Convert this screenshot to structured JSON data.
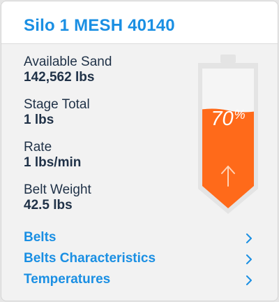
{
  "header": {
    "title": "Silo 1 MESH 40140"
  },
  "metrics": [
    {
      "label": "Available Sand",
      "value": "142,562 lbs"
    },
    {
      "label": "Stage Total",
      "value": "1 lbs"
    },
    {
      "label": "Rate",
      "value": "1 lbs/min"
    },
    {
      "label": "Belt Weight",
      "value": "42.5 lbs"
    }
  ],
  "gauge": {
    "percent_value": "70",
    "percent_sign": "%",
    "fill_fraction": 0.7,
    "fill_color": "#ff6a1a",
    "shell_color": "#e4e4e4",
    "indicator_icon": "arrow-up-icon"
  },
  "links": [
    {
      "label": "Belts",
      "icon": "chevron-right-icon"
    },
    {
      "label": "Belts Characteristics",
      "icon": "chevron-right-icon"
    },
    {
      "label": "Temperatures",
      "icon": "chevron-right-icon"
    }
  ],
  "colors": {
    "accent": "#1a8fe3",
    "text": "#1f3147",
    "gauge_fill": "#ff6a1a"
  }
}
